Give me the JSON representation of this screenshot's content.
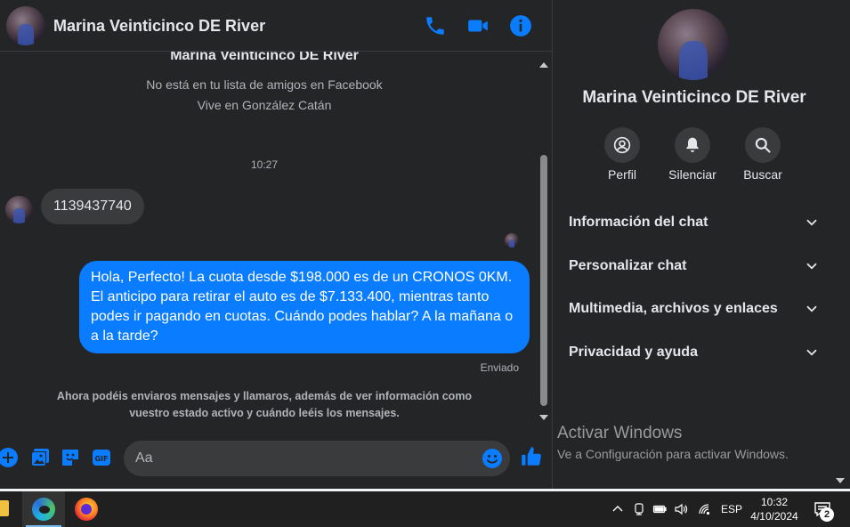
{
  "header": {
    "name": "Marina Veinticinco DE River",
    "icons": [
      "phone-icon",
      "video-icon",
      "info-icon"
    ],
    "accent": "#0a7cff"
  },
  "conversation": {
    "partial_name": "Marina Veinticinco DE River",
    "friend_status": "No está en tu lista de amigos en Facebook",
    "location": "Vive en González Catán",
    "timestamp": "10:27",
    "incoming_message": "1139437740",
    "outgoing_message": "Hola, Perfecto! La cuota desde $198.000 es de un CRONOS 0KM. El anticipo para retirar el auto es de $7.133.400, mientras tanto podes ir pagando en cuotas. Cuándo podes hablar? A la mañana o a la tarde?",
    "sent_status": "Enviado",
    "notice": "Ahora podéis enviaros mensajes y llamaros, además de ver información como vuestro estado activo y cuándo leéis los mensajes."
  },
  "composer": {
    "placeholder": "Aa",
    "icons": [
      "plus-icon",
      "image-icon",
      "sticker-icon",
      "gif-icon",
      "emoji-icon",
      "like-icon"
    ]
  },
  "sidebar": {
    "name": "Marina Veinticinco DE River",
    "actions": [
      {
        "label": "Perfil",
        "icon": "profile-icon"
      },
      {
        "label": "Silenciar",
        "icon": "bell-icon"
      },
      {
        "label": "Buscar",
        "icon": "search-icon"
      }
    ],
    "sections": [
      "Información del chat",
      "Personalizar chat",
      "Multimedia, archivos y enlaces",
      "Privacidad y ayuda"
    ]
  },
  "watermark": {
    "title": "Activar Windows",
    "subtitle": "Ve a Configuración para activar Windows."
  },
  "taskbar": {
    "apps": [
      "edge-icon",
      "firefox-icon"
    ],
    "language": "ESP",
    "time": "10:32",
    "date": "4/10/2024",
    "notification_count": "2"
  }
}
